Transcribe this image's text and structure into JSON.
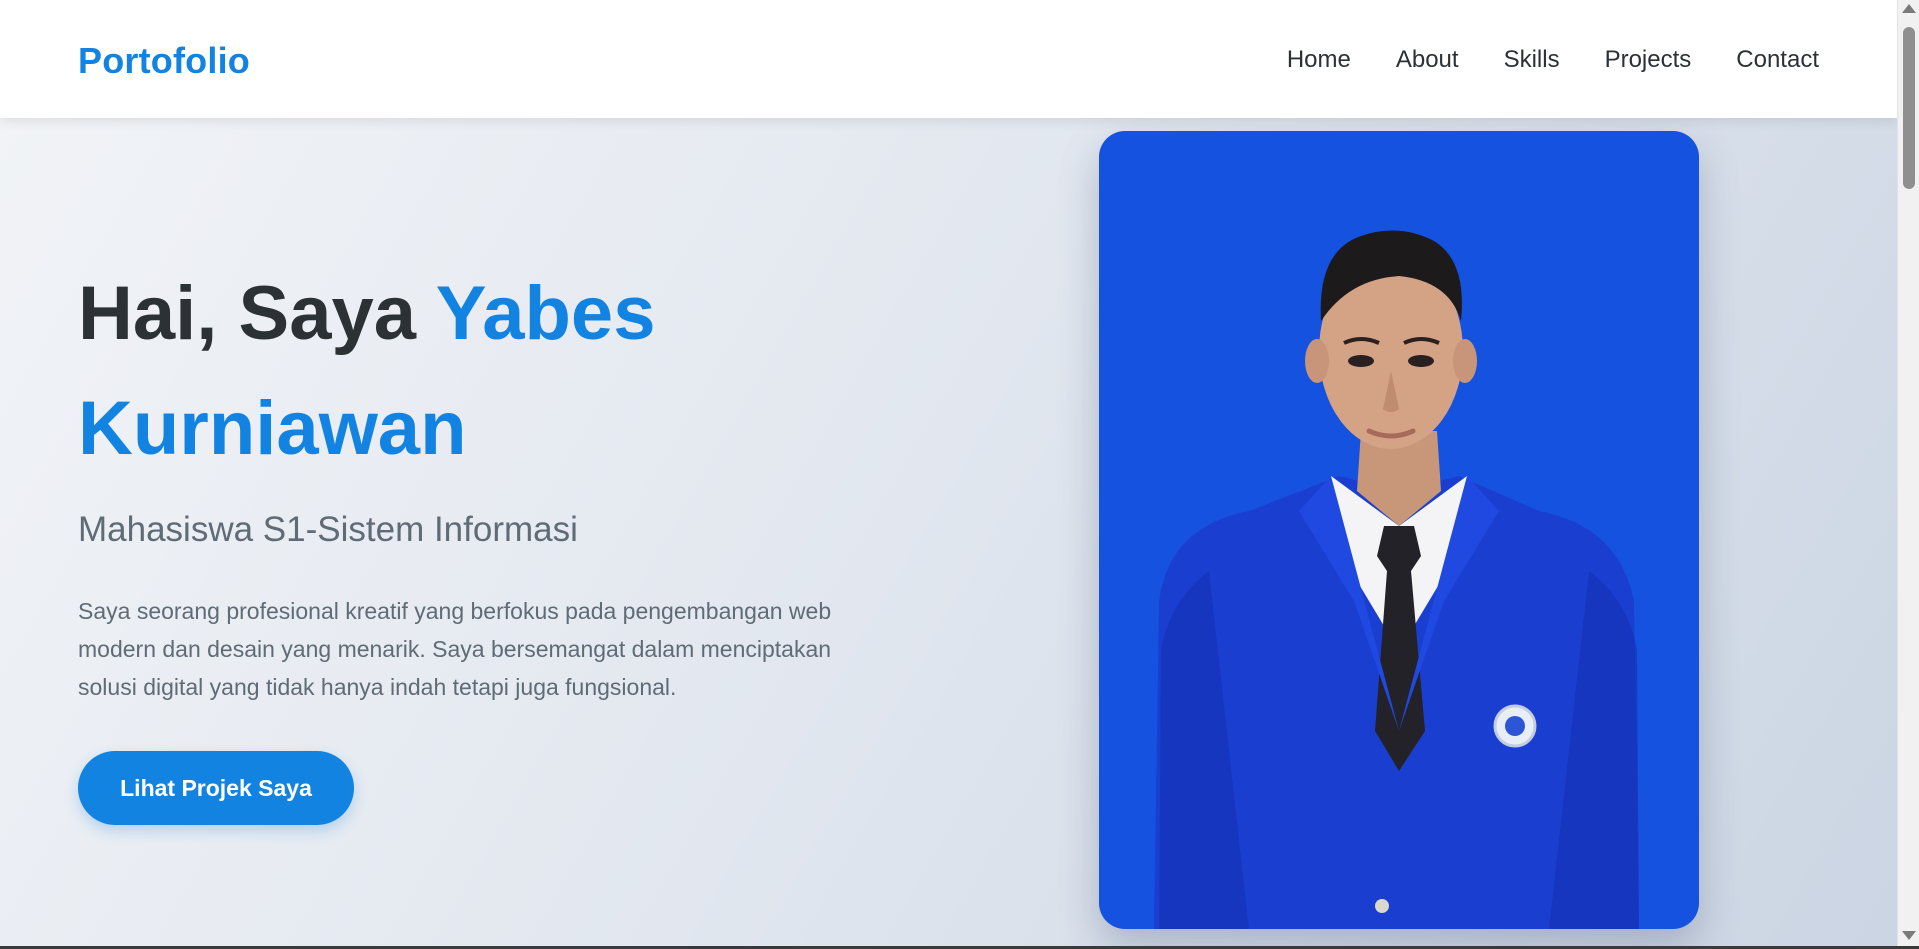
{
  "navbar": {
    "brand": "Portofolio",
    "links": [
      {
        "label": "Home"
      },
      {
        "label": "About"
      },
      {
        "label": "Skills"
      },
      {
        "label": "Projects"
      },
      {
        "label": "Contact"
      }
    ]
  },
  "hero": {
    "greeting": "Hai, Saya ",
    "name": "Yabes Kurniawan",
    "subtitle": "Mahasiswa S1-Sistem Informasi",
    "description": "Saya seorang profesional kreatif yang berfokus pada pengembangan web modern dan desain yang menarik. Saya bersemangat dalam menciptakan solusi digital yang tidak hanya indah tetapi juga fungsional.",
    "cta_label": "Lihat Projek Saya"
  },
  "colors": {
    "accent": "#1283e0",
    "heading": "#2c3136",
    "muted": "#5f6b75",
    "photo_background": "#1652e0"
  }
}
